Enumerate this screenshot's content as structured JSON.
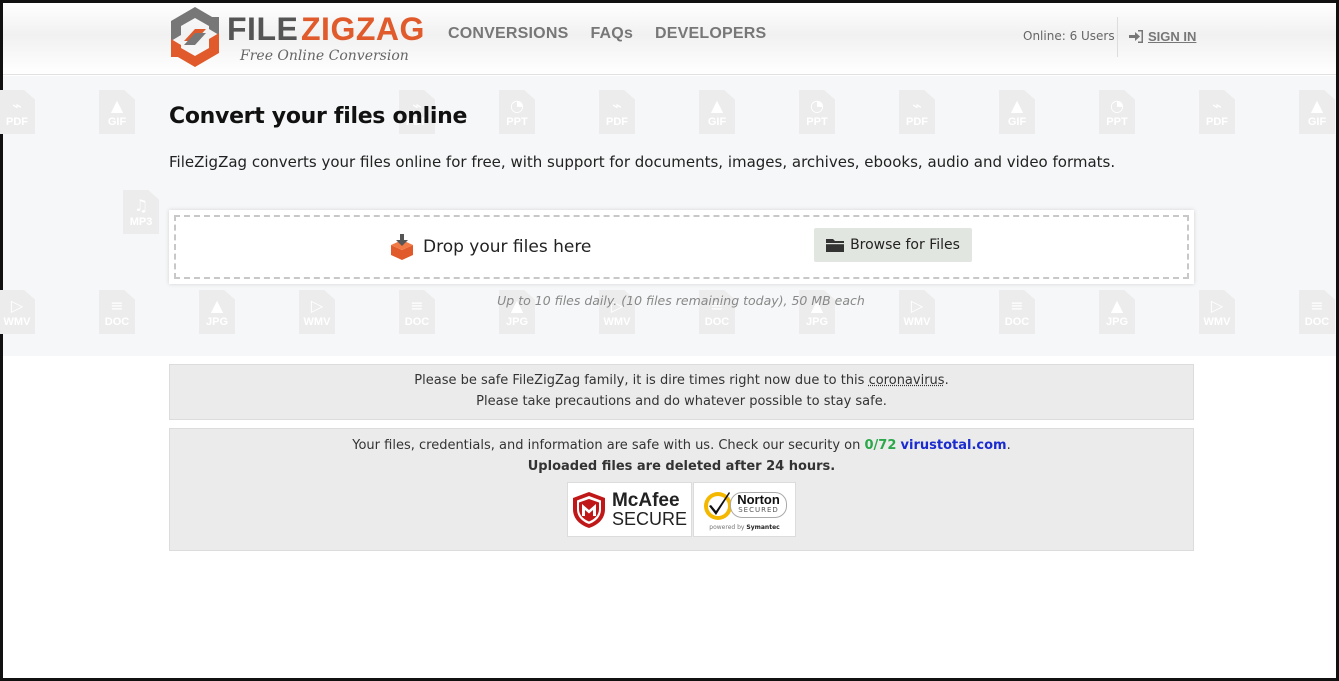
{
  "header": {
    "logo": {
      "part1": "FILE",
      "part2": "ZIGZAG",
      "tagline": "Free Online Conversion"
    },
    "nav": [
      {
        "label": "CONVERSIONS"
      },
      {
        "label": "FAQs"
      },
      {
        "label": "DEVELOPERS"
      }
    ],
    "online_text": "Online: 6 Users",
    "signin_label": "SIGN IN"
  },
  "hero": {
    "title": "Convert your files online",
    "description": "FileZigZag converts your files online for free, with support for documents, images, archives, ebooks, audio and video formats.",
    "drop_label": "Drop your files here",
    "browse_label": "Browse for Files",
    "limit_note": "Up to 10 files daily. (10 files remaining today), 50 MB each"
  },
  "background_icons": [
    [
      "PDF",
      "GIF",
      "PDF",
      "PPT",
      "PDF",
      "GIF",
      "PPT",
      "PDF",
      "GIF",
      "PPT",
      "PDF",
      "GIF"
    ],
    [
      "MP3"
    ],
    [
      "WMV",
      "DOC",
      "JPG",
      "WMV",
      "DOC",
      "JPG",
      "WMV",
      "DOC",
      "JPG",
      "WMV",
      "DOC",
      "JPG",
      "WMV",
      "DOC"
    ]
  ],
  "notices": {
    "covid": {
      "line1_prefix": "Please be safe FileZigZag family, it is dire times right now due to this ",
      "line1_link": "coronavirus",
      "line1_suffix": ".",
      "line2": "Please take precautions and do whatever possible to stay safe."
    },
    "security": {
      "line1_prefix": "Your files, credentials, and information are safe with us. Check our security on ",
      "score": "0/72",
      "site": "virustotal.com",
      "line1_suffix": ".",
      "line2": "Uploaded files are deleted after 24 hours.",
      "mcafee_name": "McAfee",
      "mcafee_sub": "SECURE",
      "norton_name": "Norton",
      "norton_sub": "SECURED",
      "norton_powered_prefix": "powered by ",
      "norton_powered_brand": "Symantec"
    }
  },
  "colors": {
    "accent_orange": "#e05a2b",
    "logo_gray": "#555555",
    "green": "#2aa84a",
    "link_blue": "#1a2bd0"
  }
}
